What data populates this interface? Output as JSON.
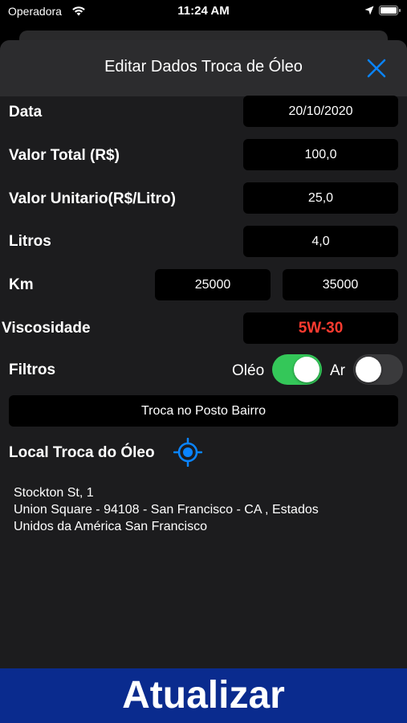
{
  "status_bar": {
    "carrier": "Operadora",
    "time": "11:24 AM"
  },
  "header": {
    "title": "Editar Dados Troca de Óleo",
    "close_icon": "close-icon",
    "accent_color": "#0a84ff"
  },
  "form": {
    "date": {
      "label": "Data",
      "value": "20/10/2020"
    },
    "total": {
      "label": "Valor Total (R$)",
      "value": "100,0"
    },
    "unit_price": {
      "label": "Valor Unitario(R$/Litro)",
      "value": "25,0"
    },
    "liters": {
      "label": "Litros",
      "value": "4,0"
    },
    "km": {
      "label": "Km",
      "value_start": "25000",
      "value_end": "35000"
    },
    "viscosity": {
      "label": "Viscosidade",
      "value": "5W-30",
      "value_color": "#ff3b30"
    },
    "filters": {
      "label": "Filtros",
      "oil": {
        "label": "Oléo",
        "on": true
      },
      "air": {
        "label": "Ar",
        "on": false
      }
    },
    "place_name": "Troca no Posto Bairro"
  },
  "location": {
    "label": "Local Troca do Óleo",
    "icon": "locate-icon",
    "address_line1": "Stockton St, 1",
    "address_line2": "Union Square -  94108 - San Francisco - CA , Estados",
    "address_line3": "Unidos da América San Francisco"
  },
  "footer": {
    "update_label": "Atualizar",
    "bar_color": "#0a2b8e"
  }
}
